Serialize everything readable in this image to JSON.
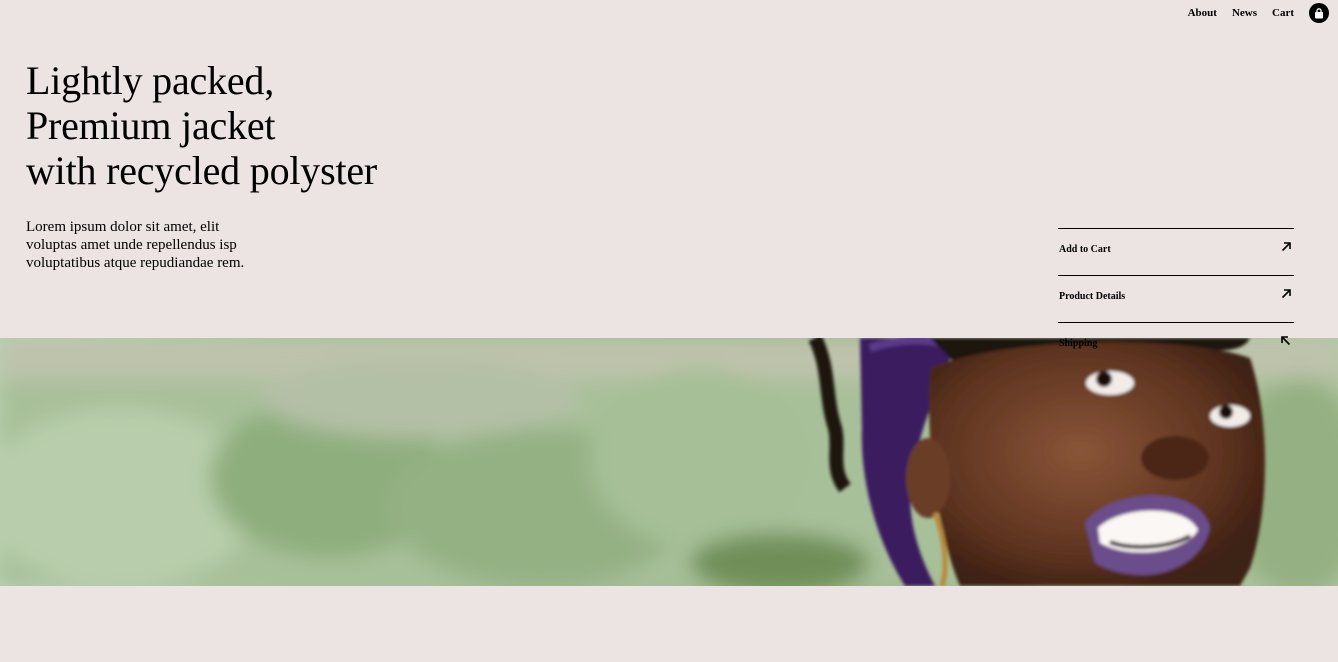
{
  "nav": {
    "items": [
      "About",
      "News",
      "Cart"
    ],
    "cart_icon": "shopping-bag-icon"
  },
  "hero": {
    "title_lines": [
      "Lightly packed,",
      "Premium jacket",
      "with recycled polyster"
    ],
    "description": "Lorem ipsum dolor sit amet, elit voluptas amet unde repellendus isp voluptatibus atque repudiandae rem."
  },
  "actions": [
    {
      "label": "Add to Cart",
      "icon": "arrow-up-right-icon"
    },
    {
      "label": "Product Details",
      "icon": "arrow-up-right-icon"
    },
    {
      "label": "Shipping",
      "icon": "arrow-up-left-icon"
    }
  ],
  "colors": {
    "background": "#ece3e3",
    "text": "#000000",
    "banner_green": "#a3bd92"
  }
}
